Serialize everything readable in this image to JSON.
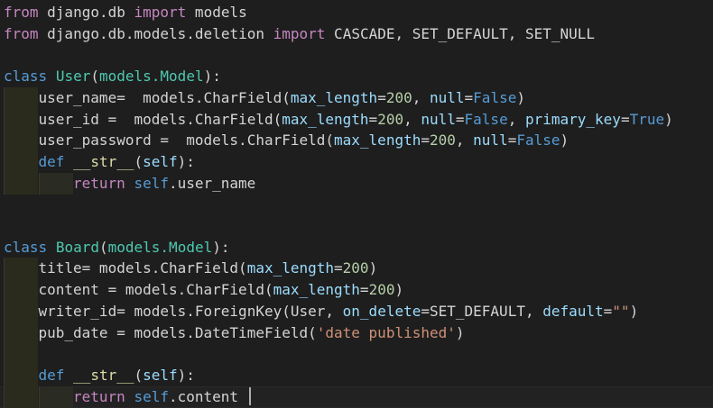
{
  "editor": {
    "lines": [
      {
        "tokens": [
          {
            "t": "from",
            "c": "kw-ctrl"
          },
          {
            "t": " django.db ",
            "c": "plain"
          },
          {
            "t": "import",
            "c": "kw-ctrl"
          },
          {
            "t": " models",
            "c": "plain"
          }
        ]
      },
      {
        "tokens": [
          {
            "t": "from",
            "c": "kw-ctrl"
          },
          {
            "t": " django.db.models.deletion ",
            "c": "plain"
          },
          {
            "t": "import",
            "c": "kw-ctrl"
          },
          {
            "t": " CASCADE, SET_DEFAULT, SET_NULL",
            "c": "plain"
          }
        ]
      },
      {
        "tokens": []
      },
      {
        "tokens": [
          {
            "t": "class",
            "c": "kw"
          },
          {
            "t": " ",
            "c": "plain"
          },
          {
            "t": "User",
            "c": "cls"
          },
          {
            "t": "(",
            "c": "plain"
          },
          {
            "t": "models.Model",
            "c": "cls"
          },
          {
            "t": "):",
            "c": "plain"
          }
        ]
      },
      {
        "indent": 1,
        "tokens": [
          {
            "t": "user_name=  models.CharField(",
            "c": "plain"
          },
          {
            "t": "max_length",
            "c": "param"
          },
          {
            "t": "=",
            "c": "plain"
          },
          {
            "t": "200",
            "c": "num"
          },
          {
            "t": ", ",
            "c": "plain"
          },
          {
            "t": "null",
            "c": "param"
          },
          {
            "t": "=",
            "c": "plain"
          },
          {
            "t": "False",
            "c": "kw"
          },
          {
            "t": ")",
            "c": "plain"
          }
        ]
      },
      {
        "indent": 1,
        "tokens": [
          {
            "t": "user_id =  models.CharField(",
            "c": "plain"
          },
          {
            "t": "max_length",
            "c": "param"
          },
          {
            "t": "=",
            "c": "plain"
          },
          {
            "t": "200",
            "c": "num"
          },
          {
            "t": ", ",
            "c": "plain"
          },
          {
            "t": "null",
            "c": "param"
          },
          {
            "t": "=",
            "c": "plain"
          },
          {
            "t": "False",
            "c": "kw"
          },
          {
            "t": ", ",
            "c": "plain"
          },
          {
            "t": "primary_key",
            "c": "param"
          },
          {
            "t": "=",
            "c": "plain"
          },
          {
            "t": "True",
            "c": "kw"
          },
          {
            "t": ")",
            "c": "plain"
          }
        ]
      },
      {
        "indent": 1,
        "tokens": [
          {
            "t": "user_password =  models.CharField(",
            "c": "plain"
          },
          {
            "t": "max_length",
            "c": "param"
          },
          {
            "t": "=",
            "c": "plain"
          },
          {
            "t": "200",
            "c": "num"
          },
          {
            "t": ", ",
            "c": "plain"
          },
          {
            "t": "null",
            "c": "param"
          },
          {
            "t": "=",
            "c": "plain"
          },
          {
            "t": "False",
            "c": "kw"
          },
          {
            "t": ")",
            "c": "plain"
          }
        ]
      },
      {
        "indent": 1,
        "tokens": [
          {
            "t": "def",
            "c": "kw"
          },
          {
            "t": " ",
            "c": "plain"
          },
          {
            "t": "__str__",
            "c": "fn"
          },
          {
            "t": "(",
            "c": "plain"
          },
          {
            "t": "self",
            "c": "param"
          },
          {
            "t": "):",
            "c": "plain"
          }
        ]
      },
      {
        "indent": 2,
        "tokens": [
          {
            "t": "return",
            "c": "kw-ctrl"
          },
          {
            "t": " ",
            "c": "plain"
          },
          {
            "t": "self",
            "c": "self"
          },
          {
            "t": ".user_name",
            "c": "plain"
          }
        ]
      },
      {
        "tokens": []
      },
      {
        "tokens": []
      },
      {
        "tokens": [
          {
            "t": "class",
            "c": "kw"
          },
          {
            "t": " ",
            "c": "plain"
          },
          {
            "t": "Board",
            "c": "cls"
          },
          {
            "t": "(",
            "c": "plain"
          },
          {
            "t": "models.Model",
            "c": "cls"
          },
          {
            "t": "):",
            "c": "plain"
          }
        ]
      },
      {
        "indent": 1,
        "tokens": [
          {
            "t": "title= models.CharField(",
            "c": "plain"
          },
          {
            "t": "max_length",
            "c": "param"
          },
          {
            "t": "=",
            "c": "plain"
          },
          {
            "t": "200",
            "c": "num"
          },
          {
            "t": ")",
            "c": "plain"
          }
        ]
      },
      {
        "indent": 1,
        "tokens": [
          {
            "t": "content = models.CharField(",
            "c": "plain"
          },
          {
            "t": "max_length",
            "c": "param"
          },
          {
            "t": "=",
            "c": "plain"
          },
          {
            "t": "200",
            "c": "num"
          },
          {
            "t": ")",
            "c": "plain"
          }
        ]
      },
      {
        "indent": 1,
        "tokens": [
          {
            "t": "writer_id= models.ForeignKey(User, ",
            "c": "plain"
          },
          {
            "t": "on_delete",
            "c": "param"
          },
          {
            "t": "=SET_DEFAULT, ",
            "c": "plain"
          },
          {
            "t": "default",
            "c": "param"
          },
          {
            "t": "=",
            "c": "plain"
          },
          {
            "t": "\"\"",
            "c": "str"
          },
          {
            "t": ")",
            "c": "plain"
          }
        ]
      },
      {
        "indent": 1,
        "tokens": [
          {
            "t": "pub_date = models.DateTimeField(",
            "c": "plain"
          },
          {
            "t": "'date published'",
            "c": "str"
          },
          {
            "t": ")",
            "c": "plain"
          }
        ]
      },
      {
        "indent": 1,
        "tokens": []
      },
      {
        "indent": 1,
        "tokens": [
          {
            "t": "def",
            "c": "kw"
          },
          {
            "t": " ",
            "c": "plain"
          },
          {
            "t": "__str__",
            "c": "fn"
          },
          {
            "t": "(",
            "c": "plain"
          },
          {
            "t": "self",
            "c": "param"
          },
          {
            "t": "):",
            "c": "plain"
          }
        ]
      },
      {
        "indent": 2,
        "cursor": true,
        "tokens": [
          {
            "t": "return",
            "c": "kw-ctrl"
          },
          {
            "t": " ",
            "c": "plain"
          },
          {
            "t": "self",
            "c": "self"
          },
          {
            "t": ".content ",
            "c": "plain"
          }
        ]
      }
    ]
  }
}
